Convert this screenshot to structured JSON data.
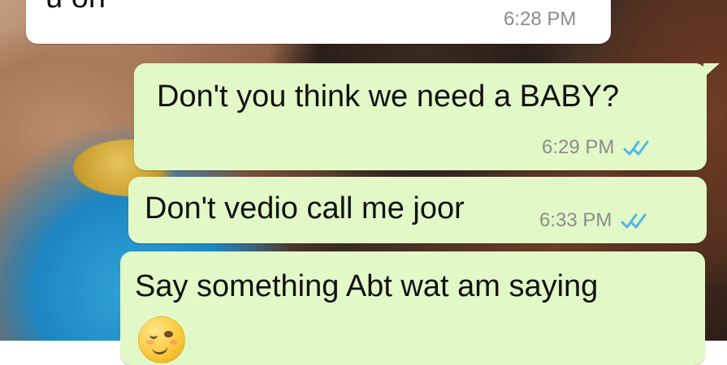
{
  "messages": [
    {
      "direction": "incoming",
      "text": "u oh",
      "time": "6:28 PM"
    },
    {
      "direction": "outgoing",
      "text": "Don't you think we need a BABY?",
      "time": "6:29 PM",
      "status_icon": "double-check-icon"
    },
    {
      "direction": "outgoing",
      "text": "Don't vedio call me joor",
      "time": "6:33 PM",
      "status_icon": "double-check-icon"
    },
    {
      "direction": "outgoing",
      "text": "Say something Abt wat am saying",
      "emoji_icon": "winking-face-emoji-icon"
    }
  ],
  "colors": {
    "incoming_bubble": "#ffffff",
    "outgoing_bubble": "#e2f8c7",
    "message_text": "#111111",
    "meta_text": "#8c8c8c",
    "read_tick": "#4fb6ec"
  }
}
